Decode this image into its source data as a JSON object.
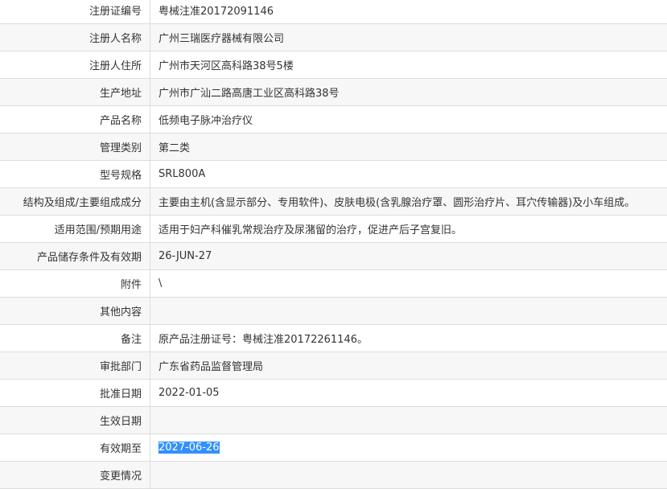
{
  "rows": [
    {
      "label": "注册证编号",
      "value": "粤械注准20172091146"
    },
    {
      "label": "注册人名称",
      "value": "广州三瑞医疗器械有限公司"
    },
    {
      "label": "注册人住所",
      "value": "广州市天河区高科路38号5楼"
    },
    {
      "label": "生产地址",
      "value": "广州市广汕二路高唐工业区高科路38号"
    },
    {
      "label": "产品名称",
      "value": "低频电子脉冲治疗仪"
    },
    {
      "label": "管理类别",
      "value": "第二类"
    },
    {
      "label": "型号规格",
      "value": "SRL800A"
    },
    {
      "label": "结构及组成/主要组成成分",
      "value": "主要由主机(含显示部分、专用软件)、皮肤电极(含乳腺治疗罩、圆形治疗片、耳穴传输器)及小车组成。"
    },
    {
      "label": "适用范围/预期用途",
      "value": "适用于妇产科催乳常规治疗及尿潴留的治疗，促进产后子宫复旧。"
    },
    {
      "label": "产品储存条件及有效期",
      "value": "26-JUN-27"
    },
    {
      "label": "附件",
      "value": "\\"
    },
    {
      "label": "其他内容",
      "value": ""
    },
    {
      "label": "备注",
      "value": "原产品注册证号：粤械注准20172261146。"
    },
    {
      "label": "审批部门",
      "value": "广东省药品监督管理局"
    },
    {
      "label": "批准日期",
      "value": "2022-01-05"
    },
    {
      "label": "生效日期",
      "value": ""
    },
    {
      "label": "有效期至",
      "value": "2027-06-26"
    },
    {
      "label": "变更情况",
      "value": ""
    }
  ]
}
